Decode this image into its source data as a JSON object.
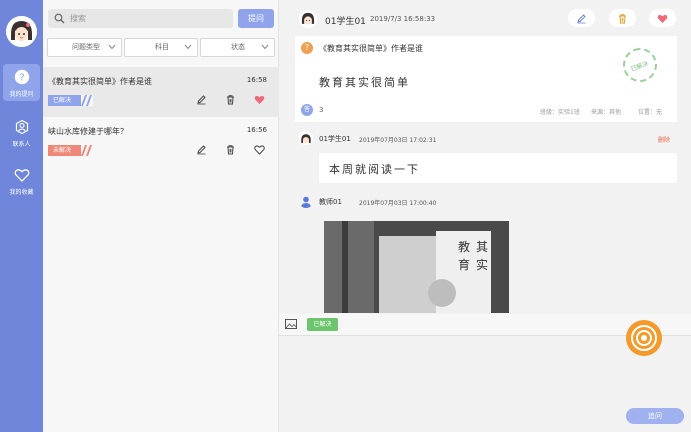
{
  "rail": {
    "items": [
      {
        "label": "我的提问",
        "icon": "question-circle-icon",
        "active": true
      },
      {
        "label": "联系人",
        "icon": "contacts-icon",
        "active": false
      },
      {
        "label": "我的收藏",
        "icon": "heart-icon",
        "active": false
      }
    ]
  },
  "list": {
    "search_placeholder": "搜索",
    "ask_button": "提问",
    "filters": [
      "问题类型",
      "科目",
      "状态"
    ],
    "items": [
      {
        "title": "《教育其实很简单》作者是谁",
        "time": "16:58",
        "status": "已解决",
        "status_color": "#8fa4ea"
      },
      {
        "title": "峡山水库修建于哪年？",
        "time": "16:56",
        "status": "未解决",
        "status_color": "#f0887a"
      }
    ]
  },
  "detail": {
    "author": "01学生01",
    "date": "2019/7/3 16:58:33",
    "question_title": "《教育其实很简单》作者是谁",
    "question_body": "教育其实很简单",
    "stamp": "已解决",
    "answer_count": "3",
    "meta": {
      "class": "班级：实验1班",
      "source": "来源：其他",
      "position": "位置：无"
    },
    "replies": [
      {
        "user": "01学生01",
        "date": "2019年07月03日 17:02:31",
        "delete": "删除",
        "text": "本周就阅读一下"
      },
      {
        "user": "教师01",
        "date": "2019年07月03日 17:00:40"
      }
    ],
    "solved_tag": "已解决",
    "reply_button": "追问"
  },
  "colors": {
    "accent": "#6f86db",
    "light_accent": "#8fa4ea",
    "solved": "#6cc46c",
    "unsolved": "#f0887a",
    "orange": "#f39a2a",
    "heart": "#f06a7a"
  }
}
